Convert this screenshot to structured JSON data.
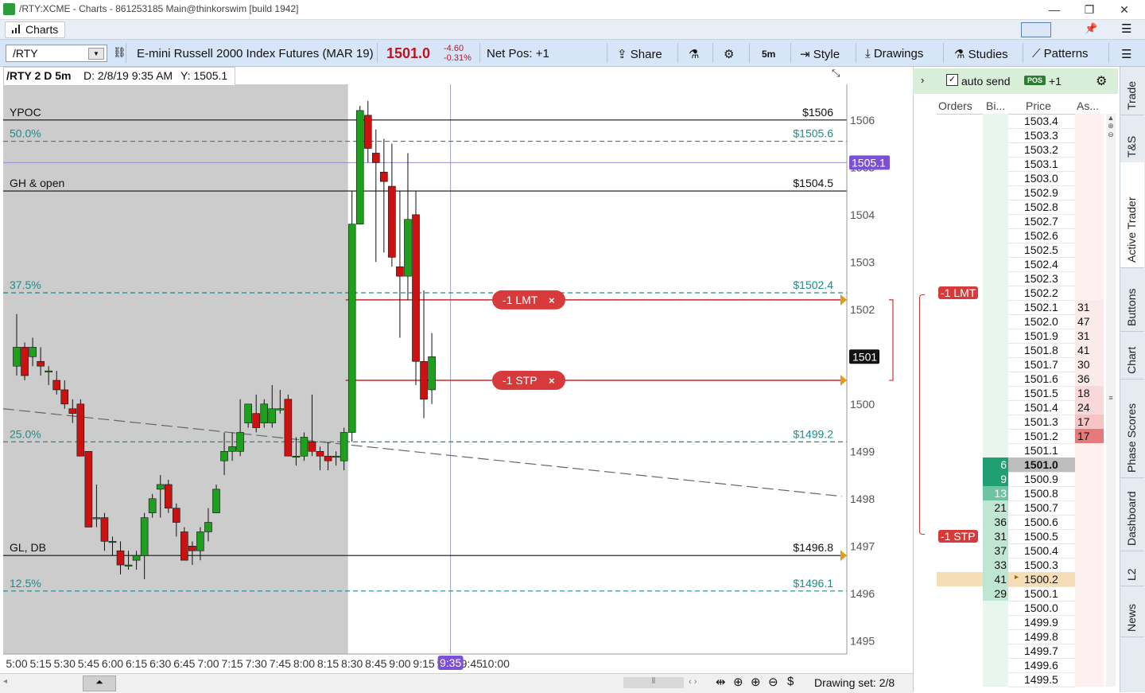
{
  "window": {
    "title": "/RTY:XCME - Charts - 861253185 Main@thinkorswim [build 1942]",
    "controls": [
      "—",
      "❐",
      "✕"
    ]
  },
  "tabstrip": {
    "charts_tab": "Charts"
  },
  "toolbar": {
    "symbol": "/RTY",
    "description": "E-mini Russell 2000 Index Futures (MAR 19)",
    "last": "1501.0",
    "change": "-4.60",
    "change_pct": "-0.31%",
    "net_pos": "Net Pos: +1",
    "share": "Share",
    "timeframe": "5m",
    "style": "Style",
    "drawings": "Drawings",
    "studies": "Studies",
    "patterns": "Patterns",
    "accent_color": "#c0141c",
    "toolbar_bg": "#d6e6f8"
  },
  "chart_header": {
    "symbol": "/RTY 2 D 5m",
    "date": "D: 2/8/19 9:35 AM",
    "y": "Y: 1505.1"
  },
  "chart_data": {
    "type": "candlestick",
    "xlabel": "",
    "ylabel": "",
    "x_tick_labels": [
      "5:00",
      "5:15",
      "5:30",
      "5:45",
      "6:00",
      "6:15",
      "6:30",
      "6:45",
      "7:00",
      "7:15",
      "7:30",
      "7:45",
      "8:00",
      "8:15",
      "8:30",
      "8:45",
      "9:00",
      "9:15",
      "9:30",
      "9:45",
      "10:00"
    ],
    "y_tick_labels": [
      "1506",
      "1505",
      "1504",
      "1503",
      "1502",
      "1501",
      "1500",
      "1499",
      "1498",
      "1497",
      "1496",
      "1495"
    ],
    "ylim": [
      1494.25,
      1506.75
    ],
    "cursor_time": "9:35",
    "cursor_price": "1505.1",
    "last_price_tag": "1501",
    "premarket_shaded": true,
    "bull_color": "#1ea01e",
    "bear_color": "#cc1111",
    "candles": [
      {
        "t": "5:00",
        "o": 1500.8,
        "h": 1501.9,
        "l": 1500.6,
        "c": 1501.2
      },
      {
        "t": "5:05",
        "o": 1501.2,
        "h": 1501.3,
        "l": 1500.5,
        "c": 1500.6
      },
      {
        "t": "5:10",
        "o": 1501.0,
        "h": 1501.4,
        "l": 1500.8,
        "c": 1501.2
      },
      {
        "t": "5:15",
        "o": 1500.9,
        "h": 1501.2,
        "l": 1500.6,
        "c": 1500.8
      },
      {
        "t": "5:20",
        "o": 1500.7,
        "h": 1500.8,
        "l": 1500.4,
        "c": 1500.7
      },
      {
        "t": "5:25",
        "o": 1500.5,
        "h": 1500.7,
        "l": 1500.2,
        "c": 1500.3
      },
      {
        "t": "5:30",
        "o": 1500.3,
        "h": 1500.5,
        "l": 1499.9,
        "c": 1500.0
      },
      {
        "t": "5:35",
        "o": 1499.9,
        "h": 1500.1,
        "l": 1499.6,
        "c": 1499.8
      },
      {
        "t": "5:40",
        "o": 1500.0,
        "h": 1500.1,
        "l": 1498.9,
        "c": 1498.9
      },
      {
        "t": "5:45",
        "o": 1499.0,
        "h": 1499.0,
        "l": 1497.4,
        "c": 1497.4
      },
      {
        "t": "5:50",
        "o": 1497.6,
        "h": 1498.3,
        "l": 1497.4,
        "c": 1497.6
      },
      {
        "t": "5:55",
        "o": 1497.6,
        "h": 1497.7,
        "l": 1496.9,
        "c": 1497.1
      },
      {
        "t": "6:00",
        "o": 1497.1,
        "h": 1497.2,
        "l": 1496.8,
        "c": 1497.1
      },
      {
        "t": "6:05",
        "o": 1496.9,
        "h": 1497.1,
        "l": 1496.4,
        "c": 1496.6
      },
      {
        "t": "6:10",
        "o": 1496.6,
        "h": 1496.9,
        "l": 1496.5,
        "c": 1496.6
      },
      {
        "t": "6:15",
        "o": 1496.7,
        "h": 1496.9,
        "l": 1496.5,
        "c": 1496.8
      },
      {
        "t": "6:20",
        "o": 1496.8,
        "h": 1497.7,
        "l": 1496.3,
        "c": 1497.6
      },
      {
        "t": "6:25",
        "o": 1497.7,
        "h": 1498.1,
        "l": 1497.6,
        "c": 1498.0
      },
      {
        "t": "6:30",
        "o": 1498.2,
        "h": 1498.5,
        "l": 1497.6,
        "c": 1498.3
      },
      {
        "t": "6:35",
        "o": 1498.3,
        "h": 1498.4,
        "l": 1497.7,
        "c": 1497.8
      },
      {
        "t": "6:40",
        "o": 1497.8,
        "h": 1497.9,
        "l": 1497.2,
        "c": 1497.5
      },
      {
        "t": "6:45",
        "o": 1497.3,
        "h": 1497.4,
        "l": 1496.7,
        "c": 1496.7
      },
      {
        "t": "6:50",
        "o": 1497.0,
        "h": 1497.1,
        "l": 1496.6,
        "c": 1496.9
      },
      {
        "t": "6:55",
        "o": 1496.9,
        "h": 1497.4,
        "l": 1496.7,
        "c": 1497.3
      },
      {
        "t": "7:00",
        "o": 1497.3,
        "h": 1497.8,
        "l": 1497.1,
        "c": 1497.5
      },
      {
        "t": "7:05",
        "o": 1497.7,
        "h": 1498.3,
        "l": 1497.7,
        "c": 1498.2
      },
      {
        "t": "7:10",
        "o": 1498.8,
        "h": 1499.4,
        "l": 1498.5,
        "c": 1499.0
      },
      {
        "t": "7:15",
        "o": 1499.0,
        "h": 1499.4,
        "l": 1498.8,
        "c": 1499.1
      },
      {
        "t": "7:20",
        "o": 1499.0,
        "h": 1500.1,
        "l": 1498.9,
        "c": 1499.4
      },
      {
        "t": "7:25",
        "o": 1499.6,
        "h": 1500.0,
        "l": 1499.5,
        "c": 1500.0
      },
      {
        "t": "7:30",
        "o": 1499.8,
        "h": 1500.2,
        "l": 1499.4,
        "c": 1499.5
      },
      {
        "t": "7:35",
        "o": 1499.6,
        "h": 1500.1,
        "l": 1499.5,
        "c": 1500.0
      },
      {
        "t": "7:40",
        "o": 1499.6,
        "h": 1500.4,
        "l": 1499.5,
        "c": 1499.9
      },
      {
        "t": "7:45",
        "o": 1499.9,
        "h": 1500.3,
        "l": 1499.8,
        "c": 1499.9
      },
      {
        "t": "7:50",
        "o": 1500.1,
        "h": 1500.2,
        "l": 1498.9,
        "c": 1498.9
      },
      {
        "t": "7:55",
        "o": 1498.9,
        "h": 1499.3,
        "l": 1498.7,
        "c": 1498.9
      },
      {
        "t": "8:00",
        "o": 1498.9,
        "h": 1499.4,
        "l": 1498.8,
        "c": 1499.3
      },
      {
        "t": "8:05",
        "o": 1499.2,
        "h": 1500.2,
        "l": 1498.9,
        "c": 1499.0
      },
      {
        "t": "8:10",
        "o": 1499.0,
        "h": 1499.1,
        "l": 1498.6,
        "c": 1498.9
      },
      {
        "t": "8:15",
        "o": 1498.9,
        "h": 1499.2,
        "l": 1498.6,
        "c": 1498.8
      },
      {
        "t": "8:20",
        "o": 1498.9,
        "h": 1499.0,
        "l": 1498.7,
        "c": 1498.9
      },
      {
        "t": "8:25",
        "o": 1498.8,
        "h": 1499.5,
        "l": 1498.6,
        "c": 1499.4
      },
      {
        "t": "8:30",
        "o": 1499.4,
        "h": 1504.5,
        "l": 1499.2,
        "c": 1503.8
      },
      {
        "t": "8:35",
        "o": 1503.8,
        "h": 1506.3,
        "l": 1503.8,
        "c": 1506.2
      },
      {
        "t": "8:40",
        "o": 1506.1,
        "h": 1506.4,
        "l": 1505.1,
        "c": 1505.4
      },
      {
        "t": "8:45",
        "o": 1505.3,
        "h": 1505.8,
        "l": 1503.0,
        "c": 1505.1
      },
      {
        "t": "8:50",
        "o": 1504.9,
        "h": 1505.6,
        "l": 1503.2,
        "c": 1504.7
      },
      {
        "t": "8:55",
        "o": 1504.6,
        "h": 1505.5,
        "l": 1502.9,
        "c": 1503.1
      },
      {
        "t": "9:00",
        "o": 1502.9,
        "h": 1504.5,
        "l": 1501.4,
        "c": 1502.7
      },
      {
        "t": "9:05",
        "o": 1502.7,
        "h": 1505.3,
        "l": 1502.2,
        "c": 1503.9
      },
      {
        "t": "9:10",
        "o": 1504.0,
        "h": 1504.5,
        "l": 1500.4,
        "c": 1500.9
      },
      {
        "t": "9:15",
        "o": 1500.9,
        "h": 1502.4,
        "l": 1499.7,
        "c": 1500.1
      },
      {
        "t": "9:20",
        "o": 1500.3,
        "h": 1501.5,
        "l": 1500.0,
        "c": 1501.0
      }
    ]
  },
  "levels": [
    {
      "label": "YPOC",
      "price_text": "$1506",
      "price": 1506.0,
      "style": "solid",
      "color": "#111111"
    },
    {
      "label": "50.0%",
      "price_text": "$1505.6",
      "price": 1505.55,
      "style": "dashed",
      "color": "#1c8c8c"
    },
    {
      "label": "GH & open",
      "price_text": "$1504.5",
      "price": 1504.5,
      "style": "solid",
      "color": "#111111"
    },
    {
      "label": "37.5%",
      "price_text": "$1502.4",
      "price": 1502.35,
      "style": "dashed",
      "color": "#1c8c8c"
    },
    {
      "label": "25.0%",
      "price_text": "$1499.2",
      "price": 1499.2,
      "style": "dashed",
      "color": "#1c8c8c"
    },
    {
      "label": "GL, DB",
      "price_text": "$1496.8",
      "price": 1496.8,
      "style": "solid",
      "color": "#111111"
    },
    {
      "label": "12.5%",
      "price_text": "$1496.1",
      "price": 1496.05,
      "style": "dashed",
      "color": "#1c8c8c"
    }
  ],
  "orders": {
    "limit": {
      "label": "-1 LMT",
      "price": 1502.2,
      "close": "×"
    },
    "stop": {
      "label": "-1 STP",
      "price": 1500.5,
      "close": "×"
    }
  },
  "active_trader": {
    "auto_send": "auto send",
    "pos_badge": "POS",
    "pos_value": "+1",
    "columns": [
      "Orders",
      "Bi...",
      "Price",
      "As..."
    ],
    "ladder": [
      {
        "price": "1503.4",
        "bid": "",
        "ask": "",
        "order": ""
      },
      {
        "price": "1503.3",
        "bid": "",
        "ask": "",
        "order": ""
      },
      {
        "price": "1503.2",
        "bid": "",
        "ask": "",
        "order": ""
      },
      {
        "price": "1503.1",
        "bid": "",
        "ask": "",
        "order": ""
      },
      {
        "price": "1503.0",
        "bid": "",
        "ask": "",
        "order": ""
      },
      {
        "price": "1502.9",
        "bid": "",
        "ask": "",
        "order": ""
      },
      {
        "price": "1502.8",
        "bid": "",
        "ask": "",
        "order": ""
      },
      {
        "price": "1502.7",
        "bid": "",
        "ask": "",
        "order": ""
      },
      {
        "price": "1502.6",
        "bid": "",
        "ask": "",
        "order": ""
      },
      {
        "price": "1502.5",
        "bid": "",
        "ask": "",
        "order": ""
      },
      {
        "price": "1502.4",
        "bid": "",
        "ask": "",
        "order": ""
      },
      {
        "price": "1502.3",
        "bid": "",
        "ask": "",
        "order": ""
      },
      {
        "price": "1502.2",
        "bid": "",
        "ask": "",
        "order": "-1 LMT"
      },
      {
        "price": "1502.1",
        "bid": "",
        "ask": "31",
        "order": ""
      },
      {
        "price": "1502.0",
        "bid": "",
        "ask": "47",
        "order": ""
      },
      {
        "price": "1501.9",
        "bid": "",
        "ask": "31",
        "order": ""
      },
      {
        "price": "1501.8",
        "bid": "",
        "ask": "41",
        "order": ""
      },
      {
        "price": "1501.7",
        "bid": "",
        "ask": "30",
        "order": ""
      },
      {
        "price": "1501.6",
        "bid": "",
        "ask": "36",
        "order": ""
      },
      {
        "price": "1501.5",
        "bid": "",
        "ask": "18",
        "order": ""
      },
      {
        "price": "1501.4",
        "bid": "",
        "ask": "24",
        "order": ""
      },
      {
        "price": "1501.3",
        "bid": "",
        "ask": "17",
        "order": ""
      },
      {
        "price": "1501.2",
        "bid": "",
        "ask": "17",
        "order": ""
      },
      {
        "price": "1501.1",
        "bid": "",
        "ask": "",
        "order": ""
      },
      {
        "price": "1501.0",
        "bid": "6",
        "ask": "",
        "order": ""
      },
      {
        "price": "1500.9",
        "bid": "9",
        "ask": "",
        "order": ""
      },
      {
        "price": "1500.8",
        "bid": "13",
        "ask": "",
        "order": ""
      },
      {
        "price": "1500.7",
        "bid": "21",
        "ask": "",
        "order": ""
      },
      {
        "price": "1500.6",
        "bid": "36",
        "ask": "",
        "order": ""
      },
      {
        "price": "1500.5",
        "bid": "31",
        "ask": "",
        "order": "-1 STP"
      },
      {
        "price": "1500.4",
        "bid": "37",
        "ask": "",
        "order": ""
      },
      {
        "price": "1500.3",
        "bid": "33",
        "ask": "",
        "order": ""
      },
      {
        "price": "1500.2",
        "bid": "41",
        "ask": "",
        "order": ""
      },
      {
        "price": "1500.1",
        "bid": "29",
        "ask": "",
        "order": ""
      },
      {
        "price": "1500.0",
        "bid": "",
        "ask": "",
        "order": ""
      },
      {
        "price": "1499.9",
        "bid": "",
        "ask": "",
        "order": ""
      },
      {
        "price": "1499.8",
        "bid": "",
        "ask": "",
        "order": ""
      },
      {
        "price": "1499.7",
        "bid": "",
        "ask": "",
        "order": ""
      },
      {
        "price": "1499.6",
        "bid": "",
        "ask": "",
        "order": ""
      },
      {
        "price": "1499.5",
        "bid": "",
        "ask": "",
        "order": ""
      }
    ],
    "last_row": "1501.0",
    "highlight_row": "1500.2"
  },
  "side_tabs": [
    "Trade",
    "T&S",
    "Active Trader",
    "Buttons",
    "Chart",
    "Phase Scores",
    "Dashboard",
    "L2",
    "News"
  ],
  "bottom": {
    "drawing_set": "Drawing set: 2/8"
  }
}
